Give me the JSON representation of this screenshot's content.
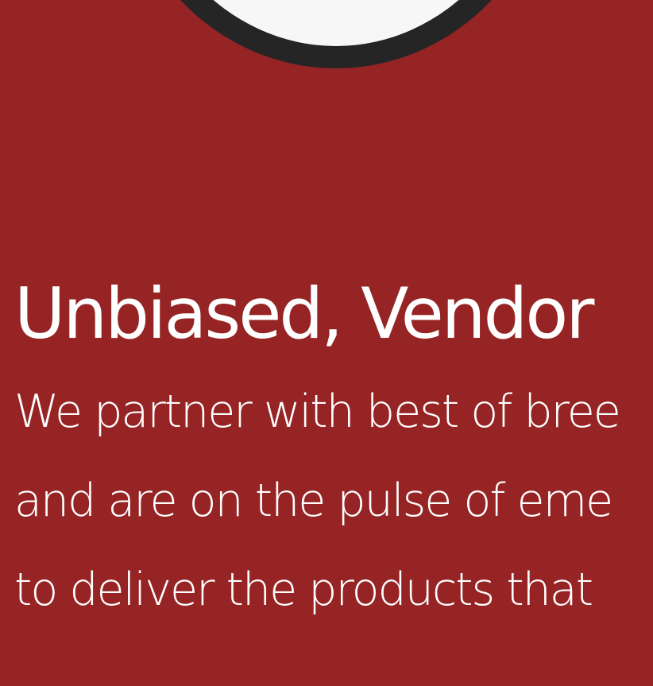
{
  "section": {
    "icon": "circle-badge-icon",
    "heading": "Unbiased, Vendor",
    "body_lines": [
      "We partner with best of bree",
      "and are on the pulse of eme",
      "to deliver the products that"
    ]
  },
  "colors": {
    "background": "#962424",
    "circle_outline": "#252525",
    "circle_fill": "#f7f7f7",
    "text": "#ffffff"
  }
}
